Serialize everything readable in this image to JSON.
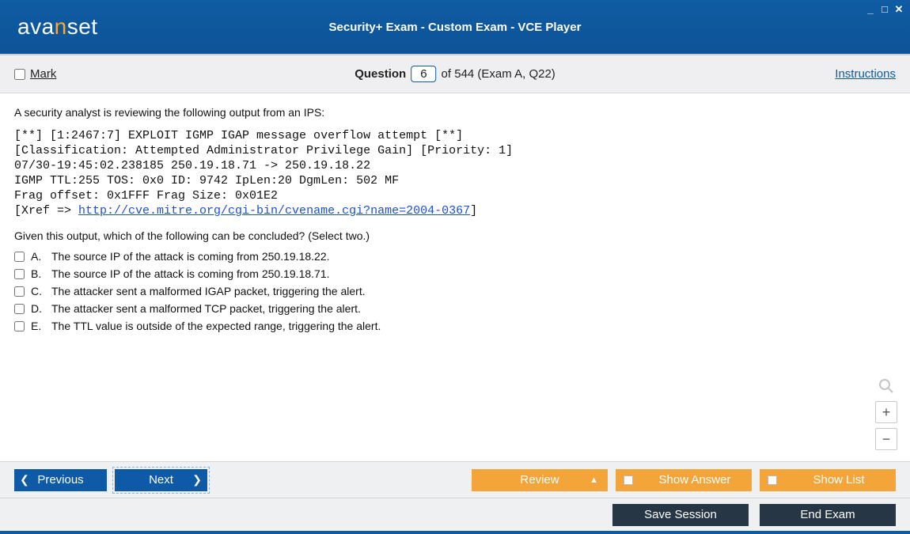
{
  "window": {
    "title": "Security+ Exam - Custom Exam - VCE Player",
    "logo_pre": "ava",
    "logo_n": "n",
    "logo_post": "set"
  },
  "infobar": {
    "mark_label": "Mark",
    "question_word": "Question",
    "question_number": "6",
    "question_rest": "of 544 (Exam A, Q22)",
    "instructions": "Instructions"
  },
  "question": {
    "prompt": "A security analyst is reviewing the following output from an IPS:",
    "output_lines": [
      "[**] [1:2467:7] EXPLOIT IGMP IGAP message overflow attempt [**]",
      "[Classification: Attempted Administrator Privilege Gain] [Priority: 1]",
      "07/30-19:45:02.238185 250.19.18.71 -> 250.19.18.22",
      "IGMP TTL:255 TOS: 0x0 ID: 9742 IpLen:20 DgmLen: 502 MF",
      "Frag offset: 0x1FFF Frag Size: 0x01E2"
    ],
    "xref_prefix": "[Xref => ",
    "xref_url": "http://cve.mitre.org/cgi-bin/cvename.cgi?name=2004-0367",
    "xref_suffix": "]",
    "subprompt": "Given this output, which of the following can be concluded? (Select two.)",
    "options": [
      {
        "letter": "A.",
        "text": "The source IP of the attack is coming from 250.19.18.22."
      },
      {
        "letter": "B.",
        "text": "The source IP of the attack is coming from 250.19.18.71."
      },
      {
        "letter": "C.",
        "text": "The attacker sent a malformed IGAP packet, triggering the alert."
      },
      {
        "letter": "D.",
        "text": "The attacker sent a malformed TCP packet, triggering the alert."
      },
      {
        "letter": "E.",
        "text": "The TTL value is outside of the expected range, triggering the alert."
      }
    ]
  },
  "nav": {
    "previous": "Previous",
    "next": "Next",
    "review": "Review",
    "show_answer": "Show Answer",
    "show_list": "Show List"
  },
  "bottom": {
    "save_session": "Save Session",
    "end_exam": "End Exam"
  },
  "glyphs": {
    "minimize": "_",
    "maximize": "□",
    "close": "✕",
    "triangle_up": "▲",
    "arrow_left": "❮",
    "arrow_right": "❯",
    "plus": "+",
    "minus": "−",
    "magnify": "🔍"
  }
}
